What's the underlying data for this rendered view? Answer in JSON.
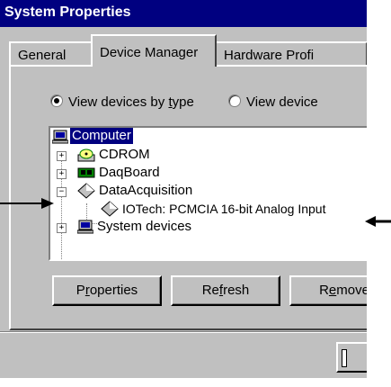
{
  "window": {
    "title": "System Properties"
  },
  "tabs": [
    {
      "label": "General"
    },
    {
      "label": "Device Manager"
    },
    {
      "label": "Hardware Profi"
    }
  ],
  "view_options": {
    "by_type_pre": "View devices by ",
    "by_type_ul": "t",
    "by_type_post": "ype",
    "by_connection": "View device",
    "selected": "by_type"
  },
  "tree": {
    "items": [
      {
        "label": "Computer",
        "icon": "computer-icon",
        "selected": true
      },
      {
        "label": "CDROM",
        "icon": "cdrom-icon",
        "expander": "+"
      },
      {
        "label": "DaqBoard",
        "icon": "board-icon",
        "expander": "+"
      },
      {
        "label": "DataAcquisition",
        "icon": "diamond-icon",
        "expander": "−"
      },
      {
        "label": "IOTech:  PCMCIA 16-bit Analog Input",
        "icon": "diamond-icon"
      },
      {
        "label": "System devices",
        "icon": "computer-icon",
        "expander": "+"
      }
    ]
  },
  "buttons": {
    "properties_pre": "P",
    "properties_ul": "r",
    "properties_post": "operties",
    "refresh_pre": "Re",
    "refresh_ul": "f",
    "refresh_post": "resh",
    "remove_pre": "R",
    "remove_ul": "e",
    "remove_post": "move"
  },
  "colors": {
    "titlebar": "#000080",
    "selection": "#000080",
    "face": "#c0c0c0"
  }
}
